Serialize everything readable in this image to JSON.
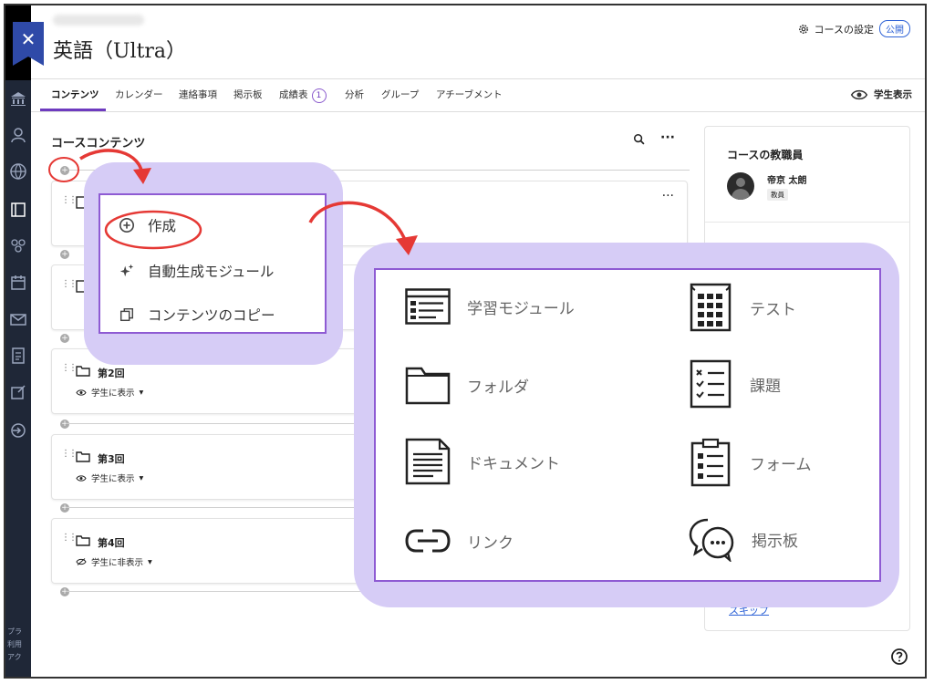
{
  "header": {
    "course_title": "英語（Ultra）",
    "settings_label": "コースの設定",
    "status_badge": "公開"
  },
  "tabs": [
    {
      "label": "コンテンツ",
      "active": true
    },
    {
      "label": "カレンダー"
    },
    {
      "label": "連絡事項"
    },
    {
      "label": "掲示板"
    },
    {
      "label": "成績表",
      "count": "1"
    },
    {
      "label": "分析"
    },
    {
      "label": "グループ"
    },
    {
      "label": "アチーブメント"
    }
  ],
  "student_view_label": "学生表示",
  "content": {
    "title": "コースコンテンツ",
    "items": [
      {
        "title": "第2回",
        "visibility": "学生に表示"
      },
      {
        "title": "第3回",
        "visibility": "学生に表示"
      },
      {
        "title": "第4回",
        "visibility": "学生に非表示"
      }
    ]
  },
  "right_panel": {
    "title": "コースの教職員",
    "teacher_name": "帝京 太朗",
    "teacher_role": "教員",
    "skip_link": "スキップ"
  },
  "sidebar_footer": [
    "プラ",
    "利用",
    "アク"
  ],
  "add_menu": [
    {
      "label": "作成",
      "icon": "plus-circle-icon"
    },
    {
      "label": "自動生成モジュール",
      "icon": "sparkle-icon"
    },
    {
      "label": "コンテンツのコピー",
      "icon": "copy-icon"
    }
  ],
  "create_menu": [
    {
      "label": "学習モジュール",
      "icon": "learning-module-icon"
    },
    {
      "label": "テスト",
      "icon": "test-icon"
    },
    {
      "label": "フォルダ",
      "icon": "folder-icon"
    },
    {
      "label": "課題",
      "icon": "assignment-icon"
    },
    {
      "label": "ドキュメント",
      "icon": "document-icon"
    },
    {
      "label": "フォーム",
      "icon": "form-icon"
    },
    {
      "label": "リンク",
      "icon": "link-icon"
    },
    {
      "label": "掲示板",
      "icon": "discussion-icon"
    }
  ],
  "colors": {
    "accent_purple": "#6e3bbf",
    "highlight_panel": "#d6ccf6",
    "annotation_red": "#e53935",
    "sidebar_bg": "#1f2737",
    "link_blue": "#2f63d6"
  }
}
